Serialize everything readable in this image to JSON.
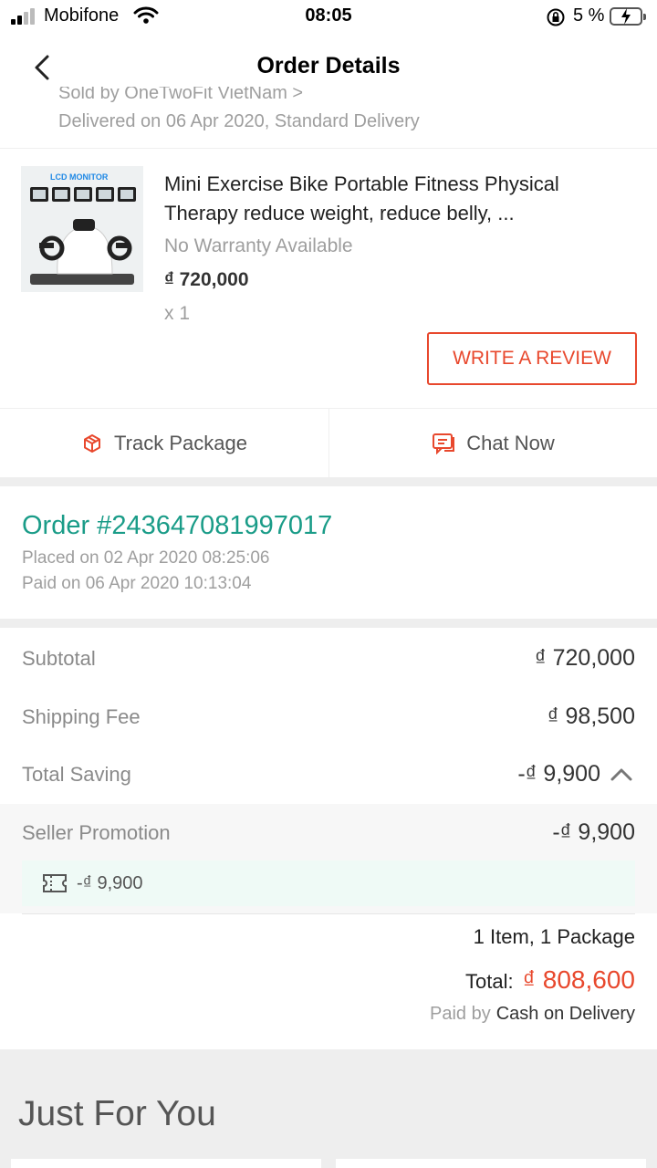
{
  "status_bar": {
    "carrier": "Mobifone",
    "time": "08:05",
    "battery_pct": "5 %"
  },
  "header": {
    "title": "Order Details"
  },
  "package": {
    "sold_by_clipped": "Sold by OneTwoFit VietNam >",
    "delivered": "Delivered on 06 Apr 2020, Standard Delivery"
  },
  "product": {
    "name": "Mini Exercise Bike Portable Fitness Physical Therapy reduce weight, reduce belly, ...",
    "image_caption": "LCD MONITOR",
    "warranty": "No Warranty Available",
    "price": "₫ 720,000",
    "qty": "x 1",
    "review_label": "WRITE A REVIEW"
  },
  "actions": {
    "track_label": "Track Package",
    "chat_label": "Chat Now"
  },
  "order": {
    "number": "Order #243647081997017",
    "placed": "Placed on 02 Apr 2020  08:25:06",
    "paid": "Paid on 06 Apr 2020  10:13:04"
  },
  "summary": {
    "subtotal_label": "Subtotal",
    "subtotal_value": "₫ 720,000",
    "shipping_label": "Shipping Fee",
    "shipping_value": "₫ 98,500",
    "saving_label": "Total Saving",
    "saving_value": "-₫ 9,900",
    "promo_label": "Seller Promotion",
    "promo_value": "-₫ 9,900",
    "voucher_value": "-₫ 9,900",
    "items_count": "1 Item, 1 Package",
    "total_label": "Total:",
    "total_value": "₫ 808,600",
    "paid_by_label": "Paid by",
    "paid_by_method": "Cash on Delivery"
  },
  "just_for_you": {
    "title": "Just For You"
  },
  "colors": {
    "accent": "#e8482d",
    "order_green": "#1a9c88",
    "voucher_bg": "#effaf6"
  }
}
